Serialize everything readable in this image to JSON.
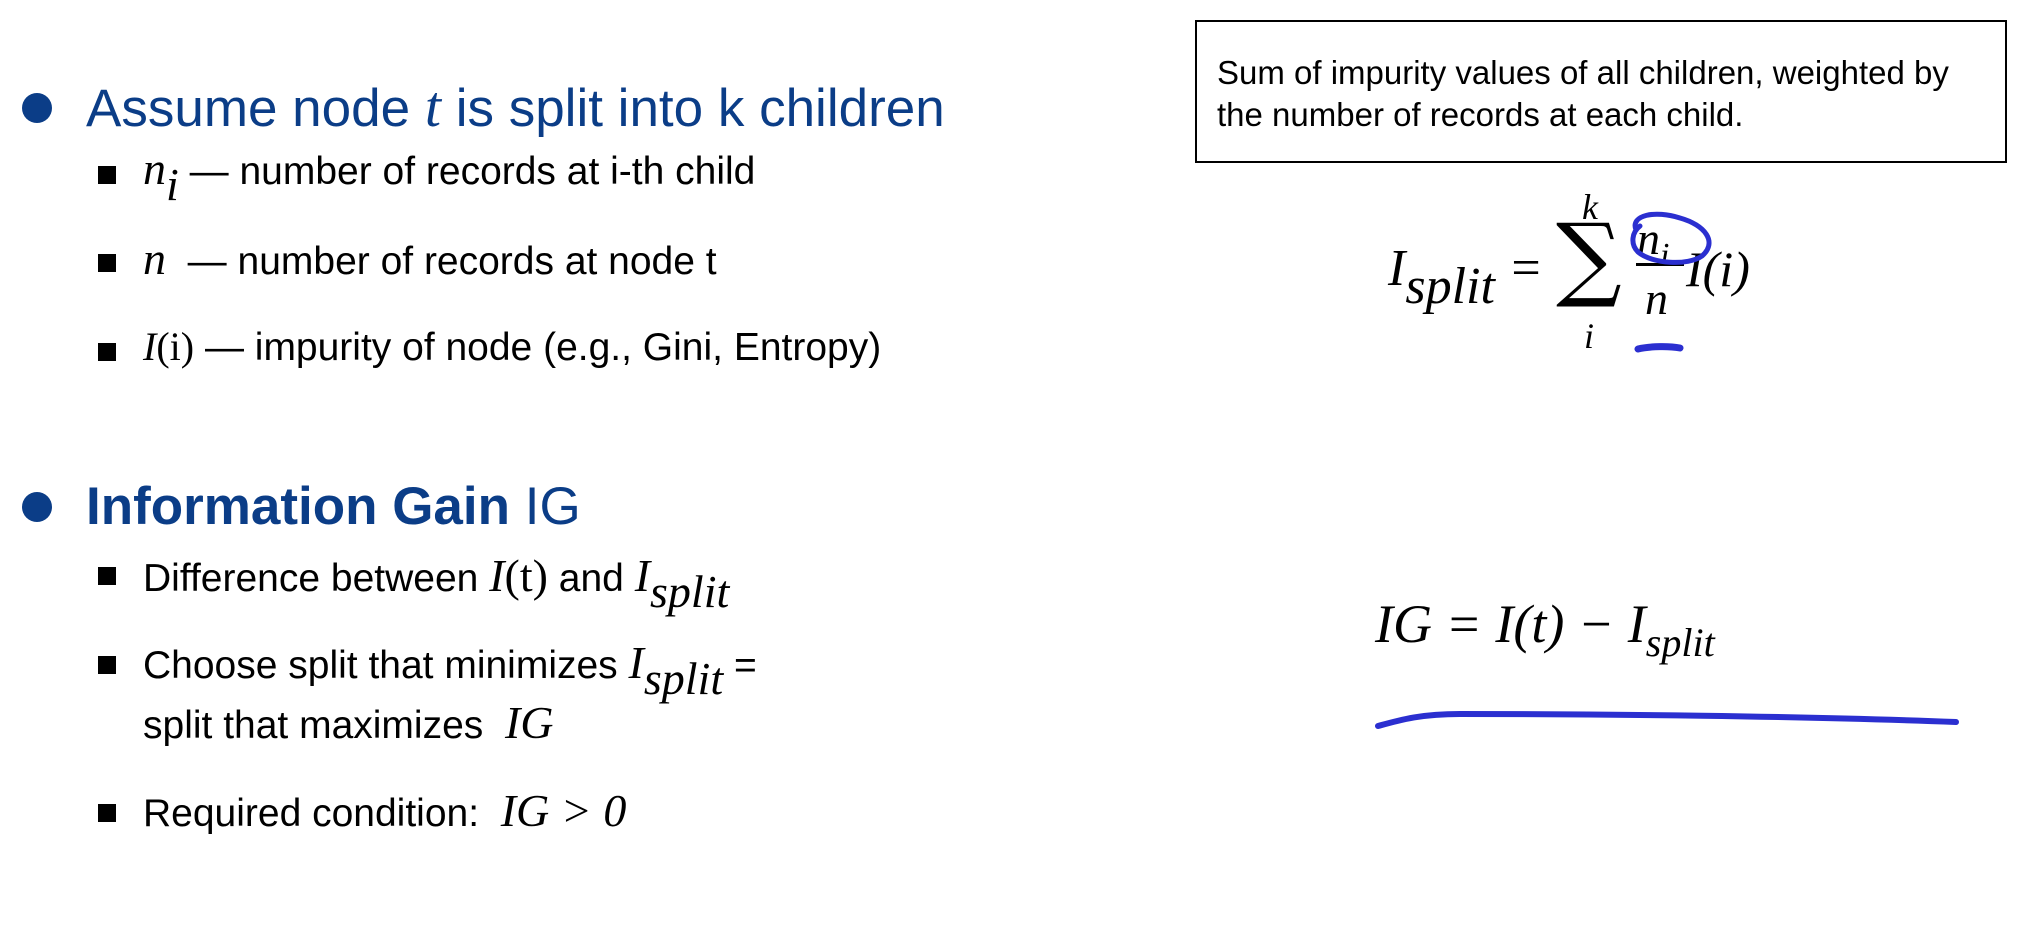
{
  "section1": {
    "heading_pre": "Assume node",
    "heading_var": "t",
    "heading_post": "is split into k children",
    "items": [
      {
        "math": "n",
        "math_sub": "i",
        "text": "— number of records at i-th child"
      },
      {
        "math": "n",
        "math_sub": "",
        "text": "— number of records at node t"
      },
      {
        "math": "I",
        "math_arg": "(i)",
        "text": "— impurity of node (e.g., Gini, Entropy)"
      }
    ]
  },
  "section2": {
    "heading_bold": "Information Gain",
    "heading_rest": "IG",
    "items": [
      {
        "text_a": "Difference between",
        "math_a": "I",
        "math_a_arg": "(t)",
        "text_b": "and",
        "math_b": "I",
        "math_b_sub": "split"
      },
      {
        "text_a": "Choose split that minimizes",
        "math_a": "I",
        "math_a_sub": "split",
        "text_b": "=",
        "text_c": "split that maximizes",
        "math_c": "IG"
      },
      {
        "text_a": "Required condition:",
        "math_a": "IG > 0"
      }
    ]
  },
  "note_box": {
    "text": "Sum of impurity values of all children, weighted by the number of records at each child."
  },
  "formula_split": {
    "lhs": "I",
    "lhs_sub": "split",
    "equals": "=",
    "sigma": "∑",
    "upper": "k",
    "lower": "i",
    "numerator": "n",
    "numerator_sub": "i",
    "denominator": "n",
    "tail": "I(i)"
  },
  "formula_ig": {
    "text": "IG = I(t) − I",
    "sub": "split"
  },
  "colors": {
    "heading": "#0b3d87",
    "ink": "#2b2fd0"
  }
}
